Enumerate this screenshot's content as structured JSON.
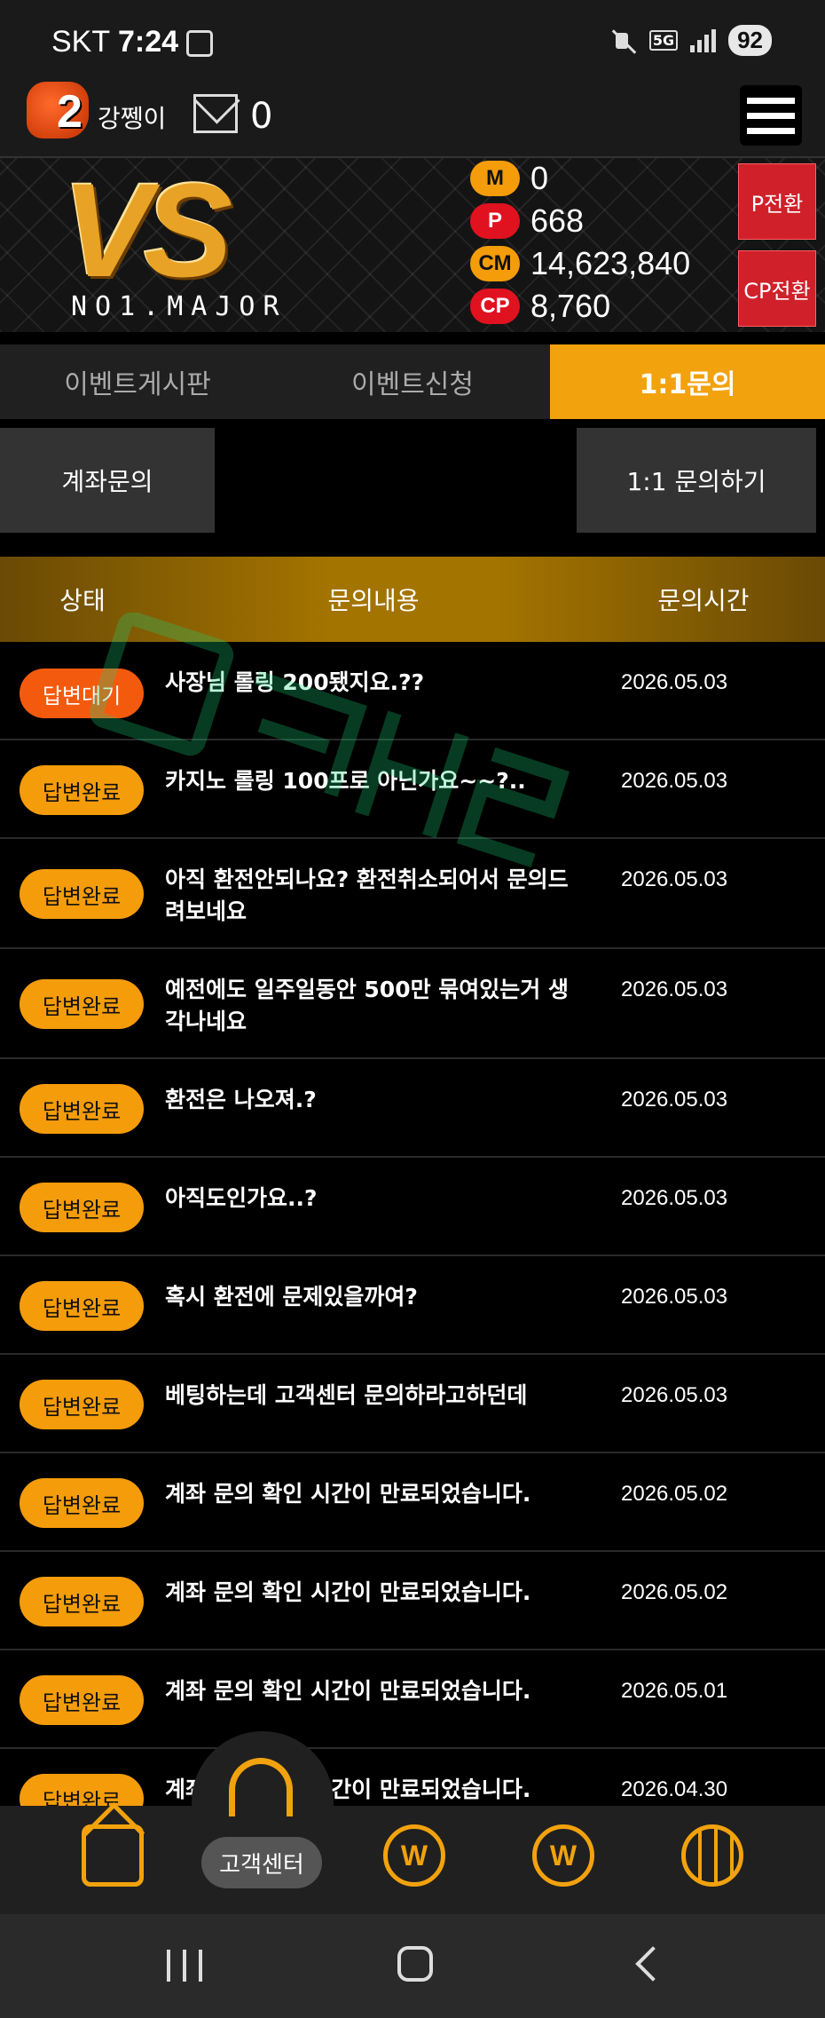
{
  "status_bar": {
    "carrier": "SKT",
    "time": "7:24",
    "network": "5G",
    "battery": "92"
  },
  "header": {
    "level": "2",
    "nickname": "강쩽이",
    "mail_count": "0"
  },
  "banner": {
    "logo": "VS",
    "logo_sub": "NO1.MAJOR",
    "balances": [
      {
        "label": "M",
        "value": "0",
        "color": "#f59c0a"
      },
      {
        "label": "P",
        "value": "668",
        "color": "#e0121f"
      },
      {
        "label": "CM",
        "value": "14,623,840",
        "color": "#f59c0a"
      },
      {
        "label": "CP",
        "value": "8,760",
        "color": "#e0121f"
      }
    ],
    "p_convert": "P전환",
    "cp_convert": "CP전환"
  },
  "tabs": [
    {
      "label": "이벤트게시판",
      "active": false
    },
    {
      "label": "이벤트신청",
      "active": false
    },
    {
      "label": "1:1문의",
      "active": true
    }
  ],
  "buttons": {
    "account_inquiry": "계좌문의",
    "new_inquiry": "1:1 문의하기"
  },
  "table": {
    "headers": {
      "status": "상태",
      "content": "문의내용",
      "time": "문의시간"
    },
    "rows": [
      {
        "status": "답변대기",
        "content": "사장님 롤링 200됐지요.??",
        "date": "2026.05.03"
      },
      {
        "status": "답변완료",
        "content": "카지노 롤링 100프로 아닌가요~~?..",
        "date": "2026.05.03"
      },
      {
        "status": "답변완료",
        "content": "아직 환전안되나요? 환전취소되어서 문의드려보네요",
        "date": "2026.05.03"
      },
      {
        "status": "답변완료",
        "content": "예전에도 일주일동안 500만 묶여있는거 생각나네요",
        "date": "2026.05.03"
      },
      {
        "status": "답변완료",
        "content": "환전은 나오져.?",
        "date": "2026.05.03"
      },
      {
        "status": "답변완료",
        "content": "아직도인가요..?",
        "date": "2026.05.03"
      },
      {
        "status": "답변완료",
        "content": "혹시 환전에 문제있을까여?",
        "date": "2026.05.03"
      },
      {
        "status": "답변완료",
        "content": "베팅하는데 고객센터 문의하라고하던데",
        "date": "2026.05.03"
      },
      {
        "status": "답변완료",
        "content": "계좌 문의 확인 시간이 만료되었습니다.",
        "date": "2026.05.02"
      },
      {
        "status": "답변완료",
        "content": "계좌 문의 확인 시간이 만료되었습니다.",
        "date": "2026.05.02"
      },
      {
        "status": "답변완료",
        "content": "계좌 문의 확인 시간이 만료되었습니다.",
        "date": "2026.05.01"
      },
      {
        "status": "답변완료",
        "content": "계좌 문의 확인 시간이 만료되었습니다.",
        "date": "2026.04.30"
      }
    ]
  },
  "bottom_nav": {
    "customer_center": "고객센터",
    "coin_1": "W",
    "coin_2": "W"
  },
  "colors": {
    "accent": "#f2a20d",
    "pending": "#f45a0e",
    "convert": "#d0202a"
  }
}
